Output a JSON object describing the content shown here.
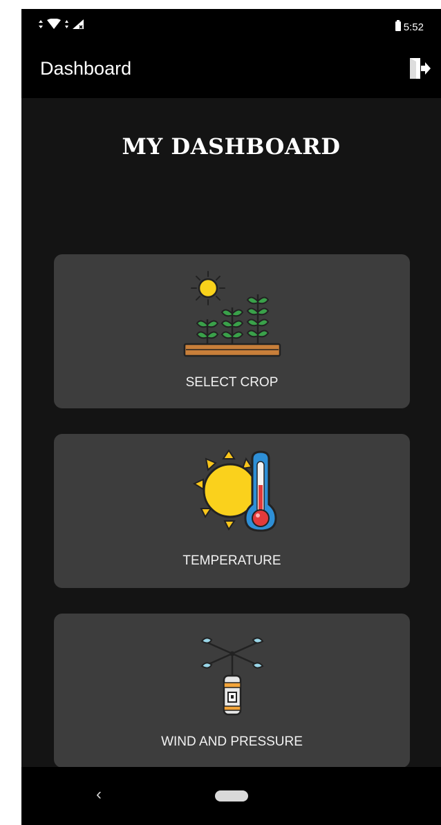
{
  "status_bar": {
    "time": "5:52",
    "icons": [
      "data-arrows-icon",
      "wifi-icon",
      "signal-icon",
      "battery-icon"
    ]
  },
  "app_bar": {
    "title": "Dashboard",
    "exit_icon": "exit-icon"
  },
  "page": {
    "heading": "MY DASHBOARD"
  },
  "cards": [
    {
      "label": "SELECT CROP",
      "icon": "crop-plants-icon"
    },
    {
      "label": "TEMPERATURE",
      "icon": "sun-thermometer-icon"
    },
    {
      "label": "WIND AND PRESSURE",
      "icon": "anemometer-icon"
    }
  ],
  "nav_bar": {
    "back_glyph": "‹",
    "icons": [
      "back-icon",
      "home-pill-icon"
    ]
  },
  "colors": {
    "background": "#141414",
    "bars": "#000000",
    "card": "#3d3d3d",
    "text": "#ffffff"
  }
}
